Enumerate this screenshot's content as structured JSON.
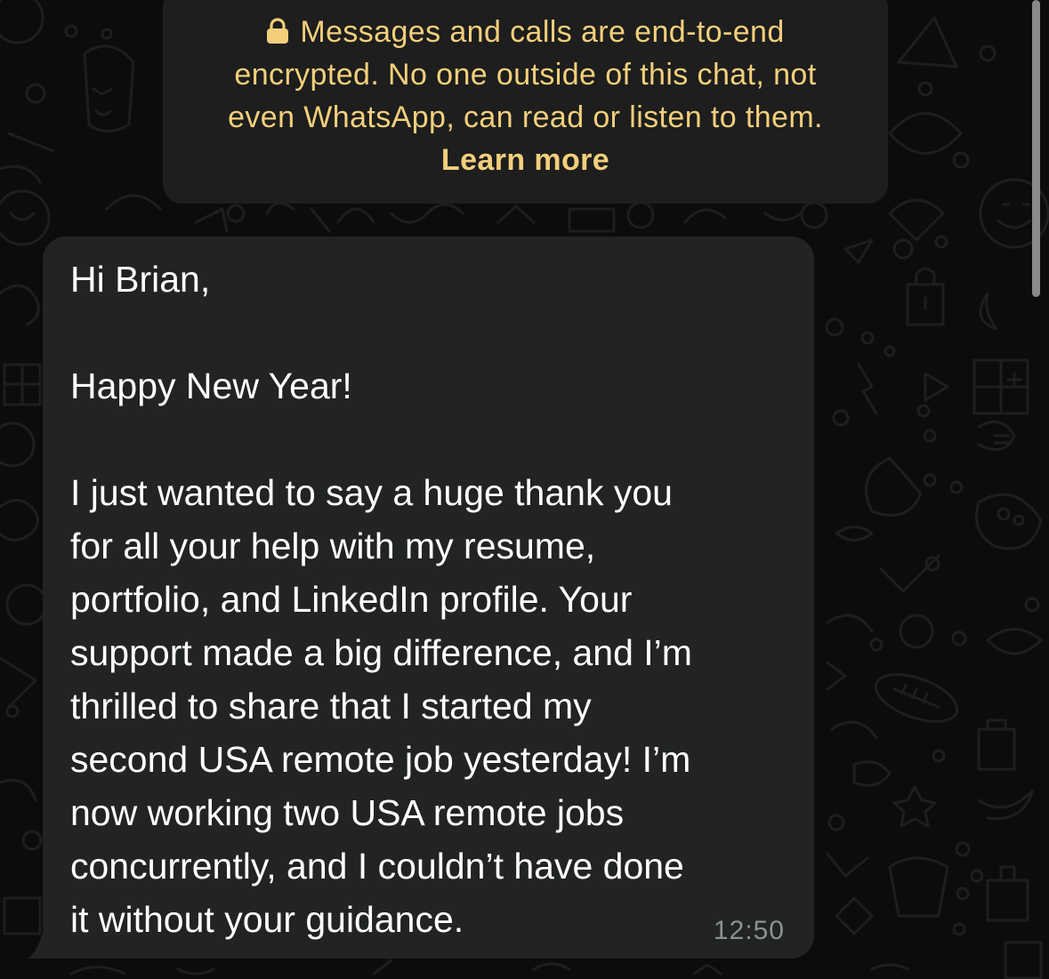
{
  "notice": {
    "lock_icon": "lock-icon",
    "line1": "Messages and calls are end-to-end",
    "line2": "encrypted. No one outside of this chat, not",
    "line3": "even WhatsApp, can read or listen to them.",
    "learn_more": "Learn more",
    "text_color": "#f3cf7c",
    "bg_color": "#1d1e1d"
  },
  "message": {
    "greeting": "Hi Brian,",
    "line_happy": "Happy New Year!",
    "body_lines": [
      "I just wanted to say a huge thank you",
      "for all your help with my resume,",
      "portfolio, and LinkedIn profile. Your",
      "support made a big difference, and I’m",
      "thrilled to share that I started my",
      "second USA remote job yesterday! I’m",
      "now working two USA remote jobs",
      "concurrently, and I couldn’t have done",
      "it without your guidance."
    ],
    "time": "12:50",
    "bubble_color": "#212423"
  }
}
